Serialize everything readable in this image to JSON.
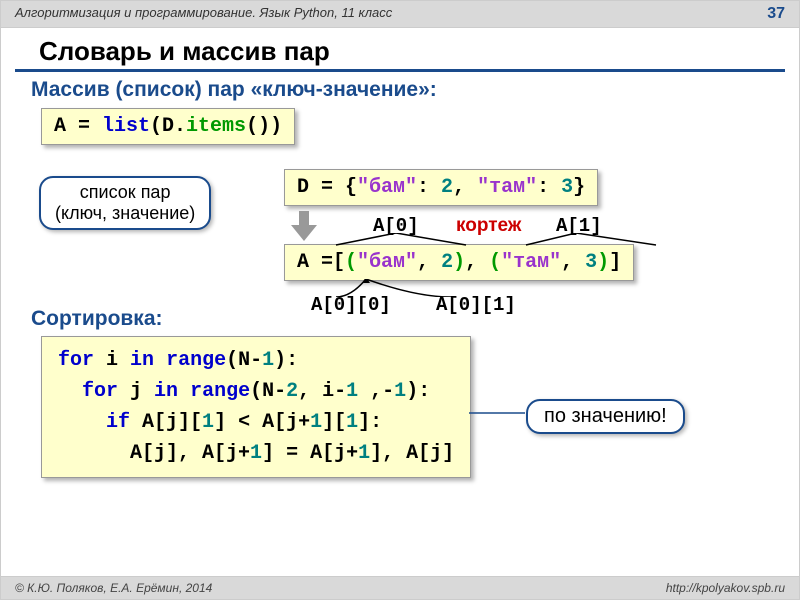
{
  "header": {
    "course": "Алгоритмизация и программирование. Язык Python, 11 класс",
    "page": "37"
  },
  "title": "Словарь и массив пар",
  "subtitle": "Массив (список) пар «ключ-значение»:",
  "code1": {
    "a": "A = ",
    "list": "list",
    "p1": "(D.",
    "items": "items",
    "p2": "())"
  },
  "callout1": {
    "l1": "список пар",
    "l2": "(ключ, значение)"
  },
  "code2": {
    "d": "D = {",
    "s1": "\"бам\"",
    "c1": ": ",
    "n1": "2",
    "cm": ", ",
    "s2": "\"там\"",
    "c2": ": ",
    "n2": "3",
    "end": "}"
  },
  "anno": {
    "a0": "A[0]",
    "a1": "A[1]",
    "tuple": "кортеж",
    "a00": "A[0][0]",
    "a01": "A[0][1]"
  },
  "code3": {
    "a": "A =[",
    "p1a": "(",
    "s1": "\"бам\"",
    "c1": ", ",
    "n1": "2",
    "p1b": ")",
    "cm": ", ",
    "p2a": "(",
    "s2": "\"там\"",
    "c2": ", ",
    "n2": "3",
    "p2b": ")",
    "end": "]"
  },
  "sortLabel": "Сортировка:",
  "code4": {
    "l1": {
      "for": "for",
      "sp1": " i ",
      "in": "in",
      "sp2": " ",
      "range": "range",
      "p": "(N-",
      "n": "1",
      "e": "):"
    },
    "l2": {
      "pad": "  ",
      "for": "for",
      "sp1": " j ",
      "in": "in",
      "sp2": " ",
      "range": "range",
      "p": "(N-",
      "n2": "2",
      "c": ", i-",
      "n1": "1",
      "sp": " ,-",
      "nm1": "1",
      "e": "):"
    },
    "l3": {
      "pad": "    ",
      "if": "if",
      "sp": " A[j][",
      "n1": "1",
      "m": "] < A[j+",
      "np": "1",
      "b": "][",
      "n1b": "1",
      "e": "]:"
    },
    "l4": {
      "pad": "      ",
      "t": "A[j], A[j+",
      "n1": "1",
      "m": "] = A[j+",
      "n1b": "1",
      "e": "], A[j]"
    }
  },
  "callout2": "по значению!",
  "footer": {
    "left": "© К.Ю. Поляков, Е.А. Ерёмин, 2014",
    "right": "http://kpolyakov.spb.ru"
  }
}
